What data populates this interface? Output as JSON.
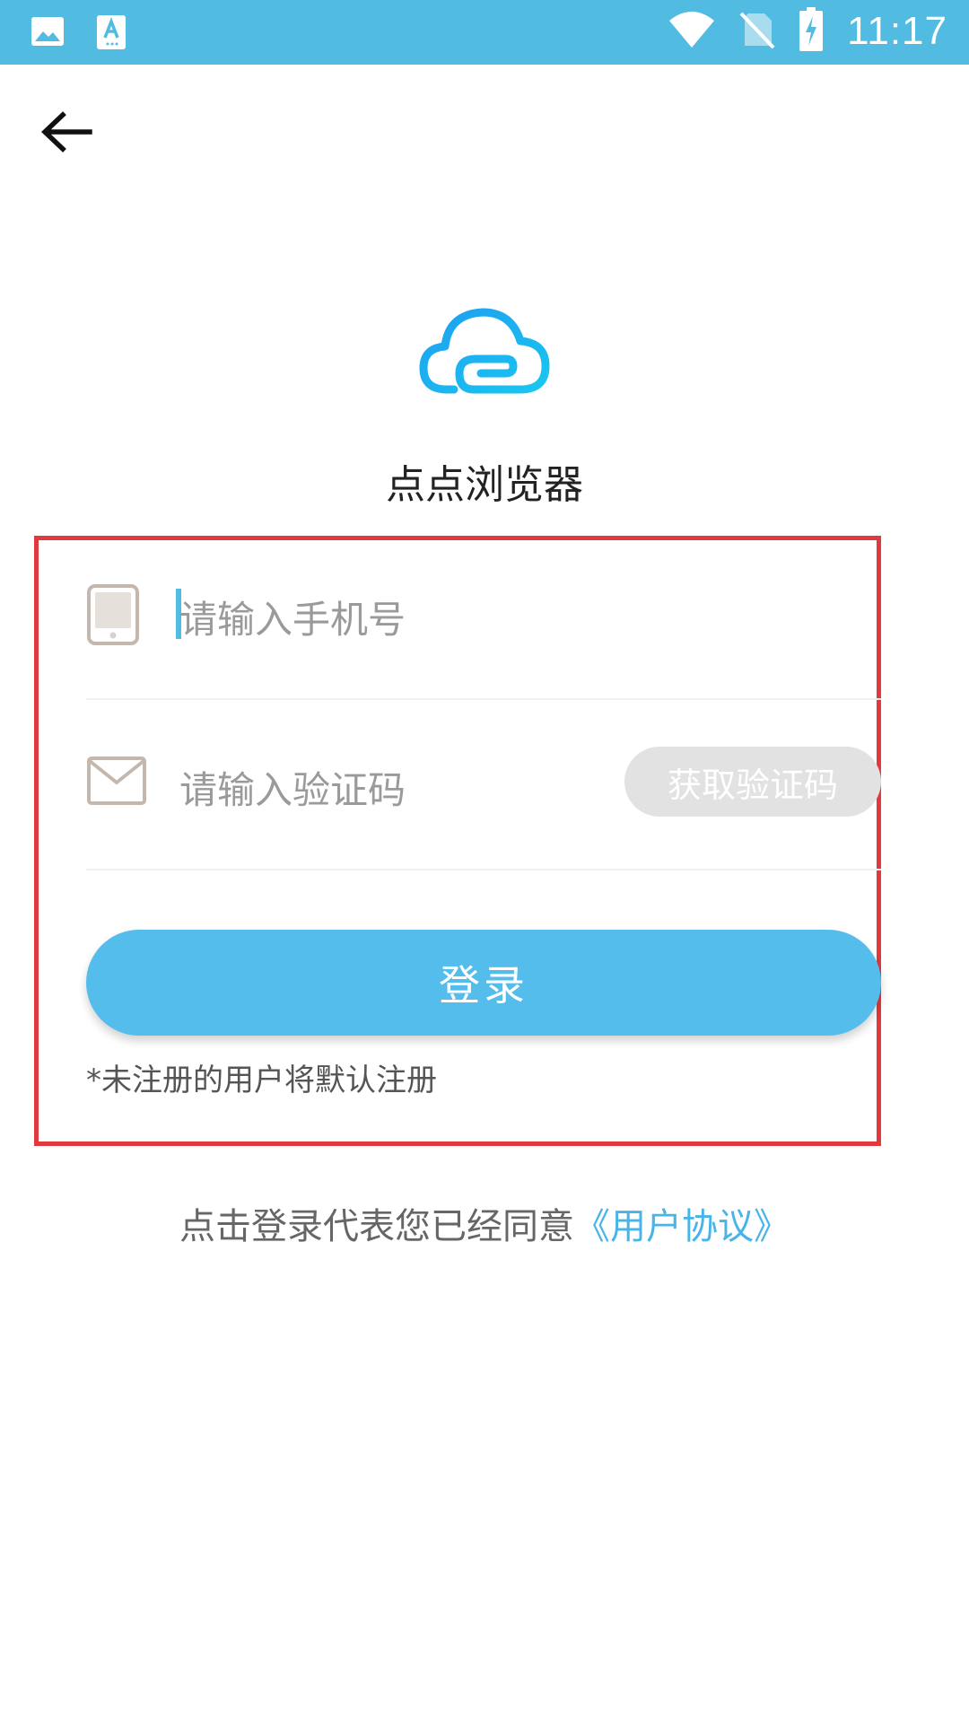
{
  "status_bar": {
    "time": "11:17",
    "left_icons": [
      "image-notification-icon",
      "text-notification-icon"
    ],
    "right_icons": [
      "wifi-icon",
      "no-sim-icon",
      "battery-charging-icon"
    ],
    "color": "#52bbe2"
  },
  "header": {
    "back_icon": "arrow-left-icon"
  },
  "brand": {
    "logo_icon": "cloud-logo-icon",
    "app_name": "点点浏览器",
    "accent_color": "#1fb0f0"
  },
  "form": {
    "phone": {
      "icon": "phone-icon",
      "placeholder": "请输入手机号",
      "value": ""
    },
    "code": {
      "icon": "envelope-icon",
      "placeholder": "请输入验证码",
      "value": "",
      "get_code_label": "获取验证码"
    },
    "login_label": "登录",
    "login_color": "#55bdec",
    "register_note": "*未注册的用户将默认注册"
  },
  "agreement": {
    "text": "点击登录代表您已经同意",
    "link_label": "《用户协议》"
  }
}
